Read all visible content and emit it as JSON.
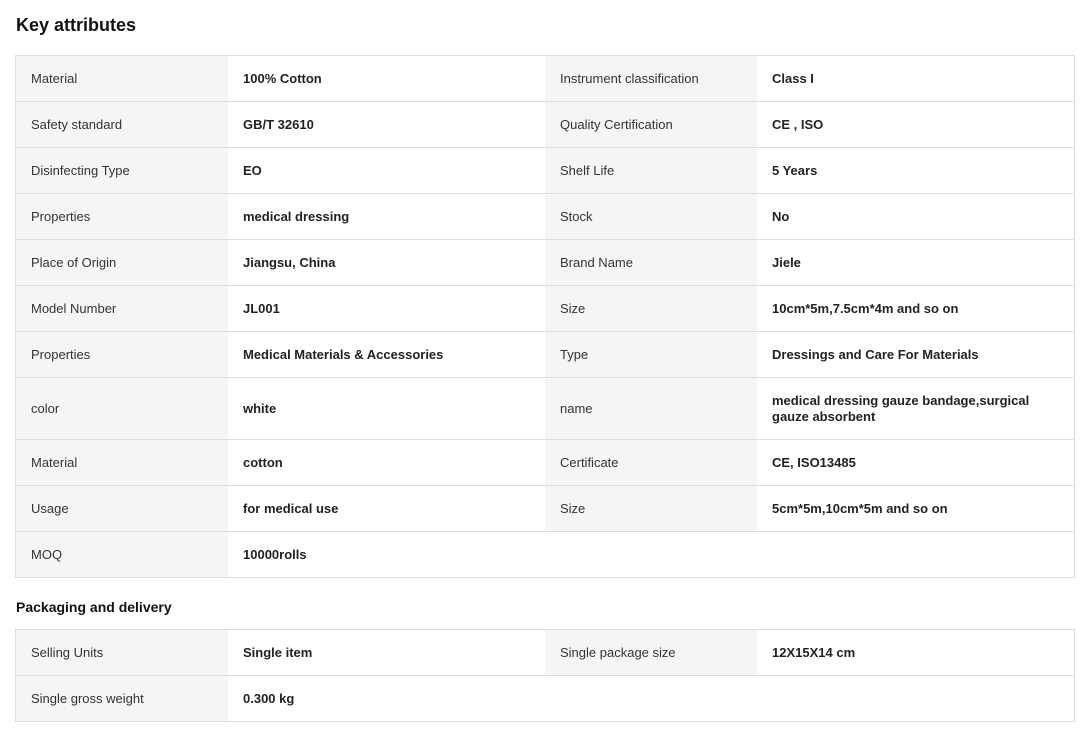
{
  "key_attributes": {
    "title": "Key attributes",
    "rows": [
      {
        "l1": "Material",
        "v1": "100% Cotton",
        "l2": "Instrument classification",
        "v2": "Class I"
      },
      {
        "l1": "Safety standard",
        "v1": "GB/T 32610",
        "l2": "Quality Certification",
        "v2": "CE , ISO"
      },
      {
        "l1": "Disinfecting Type",
        "v1": "EO",
        "l2": "Shelf Life",
        "v2": "5 Years"
      },
      {
        "l1": "Properties",
        "v1": "medical dressing",
        "l2": "Stock",
        "v2": "No"
      },
      {
        "l1": "Place of Origin",
        "v1": "Jiangsu, China",
        "l2": "Brand Name",
        "v2": "Jiele"
      },
      {
        "l1": "Model Number",
        "v1": "JL001",
        "l2": "Size",
        "v2": "10cm*5m,7.5cm*4m and so on"
      },
      {
        "l1": "Properties",
        "v1": "Medical Materials & Accessories",
        "l2": "Type",
        "v2": "Dressings and Care For Materials"
      },
      {
        "l1": "color",
        "v1": "white",
        "l2": "name",
        "v2": "medical dressing gauze bandage,surgical gauze absorbent"
      },
      {
        "l1": "Material",
        "v1": "cotton",
        "l2": "Certificate",
        "v2": "CE, ISO13485"
      },
      {
        "l1": "Usage",
        "v1": "for medical use",
        "l2": "Size",
        "v2": "5cm*5m,10cm*5m and so on"
      },
      {
        "l1": "MOQ",
        "v1": "10000rolls"
      }
    ]
  },
  "packaging": {
    "title": "Packaging and delivery",
    "rows": [
      {
        "l1": "Selling Units",
        "v1": "Single item",
        "l2": "Single package size",
        "v2": "12X15X14 cm"
      },
      {
        "l1": "Single gross weight",
        "v1": "0.300 kg"
      }
    ]
  }
}
